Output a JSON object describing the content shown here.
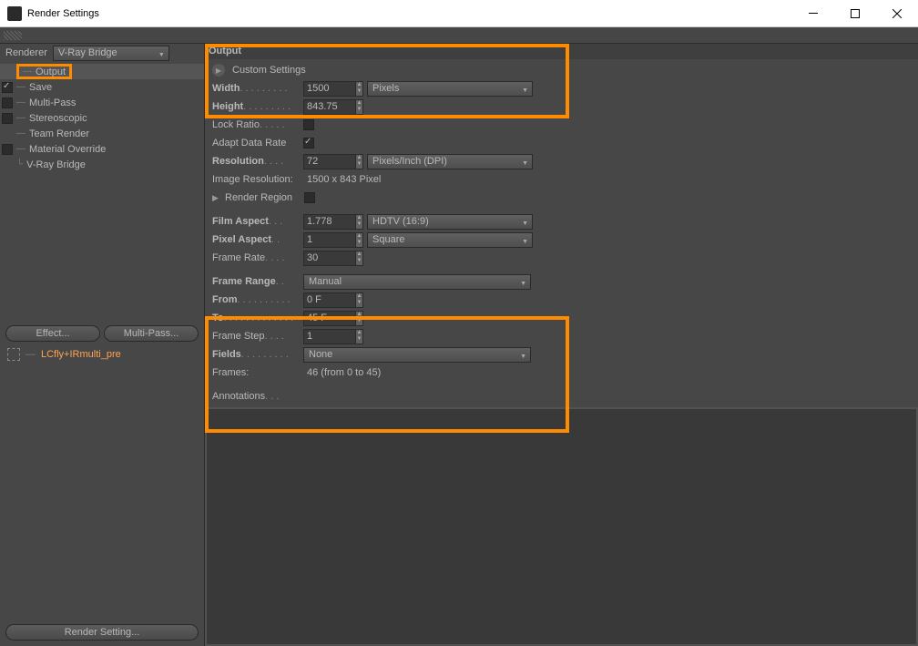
{
  "titlebar": {
    "title": "Render Settings"
  },
  "renderer": {
    "label": "Renderer",
    "value": "V-Ray Bridge"
  },
  "sidebar": {
    "items": [
      {
        "label": "Output",
        "highlighted": true
      },
      {
        "label": "Save",
        "checked": true
      },
      {
        "label": "Multi-Pass",
        "checked": false
      },
      {
        "label": "Stereoscopic",
        "checked": false
      },
      {
        "label": "Team Render"
      },
      {
        "label": "Material Override",
        "checked": false
      },
      {
        "label": "V-Ray Bridge"
      }
    ],
    "effect_btn": "Effect...",
    "multipass_btn": "Multi-Pass...",
    "preset": "LCfly+IRmulti_pre",
    "bottom": "Render Setting..."
  },
  "output": {
    "header": "Output",
    "custom_settings": "Custom Settings",
    "width_label": "Width",
    "width_value": "1500",
    "width_unit": "Pixels",
    "height_label": "Height",
    "height_value": "843.75",
    "lock_ratio_label": "Lock Ratio",
    "adapt_data_label": "Adapt Data Rate",
    "resolution_label": "Resolution",
    "resolution_value": "72",
    "resolution_unit": "Pixels/Inch (DPI)",
    "img_res_label": "Image Resolution:",
    "img_res_value": "1500 x 843 Pixel",
    "render_region_label": "Render Region",
    "film_aspect_label": "Film Aspect",
    "film_aspect_value": "1.778",
    "film_aspect_preset": "HDTV (16:9)",
    "pixel_aspect_label": "Pixel Aspect",
    "pixel_aspect_value": "1",
    "pixel_aspect_preset": "Square",
    "frame_rate_label": "Frame Rate",
    "frame_rate_value": "30",
    "frame_range_label": "Frame Range",
    "frame_range_value": "Manual",
    "from_label": "From",
    "from_value": "0 F",
    "to_label": "To",
    "to_value": "45 F",
    "frame_step_label": "Frame Step",
    "frame_step_value": "1",
    "fields_label": "Fields",
    "fields_value": "None",
    "frames_label": "Frames:",
    "frames_value": "46 (from 0 to 45)",
    "annotations_label": "Annotations"
  }
}
